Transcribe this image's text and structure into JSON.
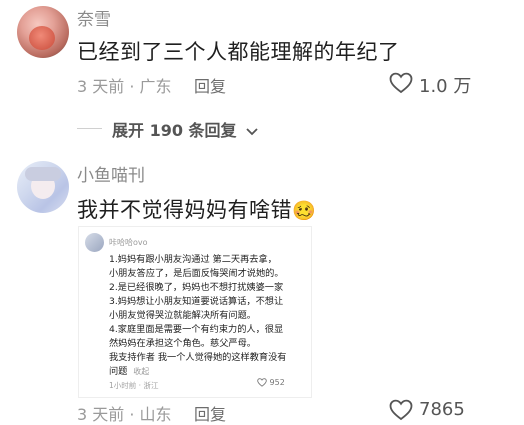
{
  "comment1": {
    "username": "奈雪",
    "text": "已经到了三个人都能理解的年纪了",
    "time": "3 天前",
    "location": "广东",
    "reply_label": "回复",
    "like_count": "1.0 万",
    "like_icon": "heart-outline-icon"
  },
  "expand_replies": {
    "label": "展开 190 条回复",
    "icon": "chevron-down-icon"
  },
  "comment2": {
    "username": "小鱼喵刊",
    "text": "我并不觉得妈妈有啥错",
    "emoji": "🥴",
    "time": "3 天前",
    "location": "山东",
    "reply_label": "回复",
    "like_count": "7865",
    "like_icon": "heart-outline-icon",
    "attached_screenshot": {
      "username": "咔哈哈ovo",
      "lines": [
        "1.妈妈有跟小朋友沟通过 第二天再去拿，",
        "小朋友答应了，是后面反悔哭闹才说她的。",
        "2.是已经很晚了，妈妈也不想打扰姨婆一家",
        "3.妈妈想让小朋友知道要说话算话，不想让",
        "小朋友觉得哭泣就能解决所有问题。",
        "4.家庭里面是需要一个有约束力的人，很显",
        "然妈妈在承担这个角色。慈父严母。",
        "我支持作者 我一个人觉得她的这样教育没有",
        "问题"
      ],
      "collapse_label": "收起",
      "time": "1小时前",
      "location": "浙江",
      "like_count": "952"
    }
  }
}
